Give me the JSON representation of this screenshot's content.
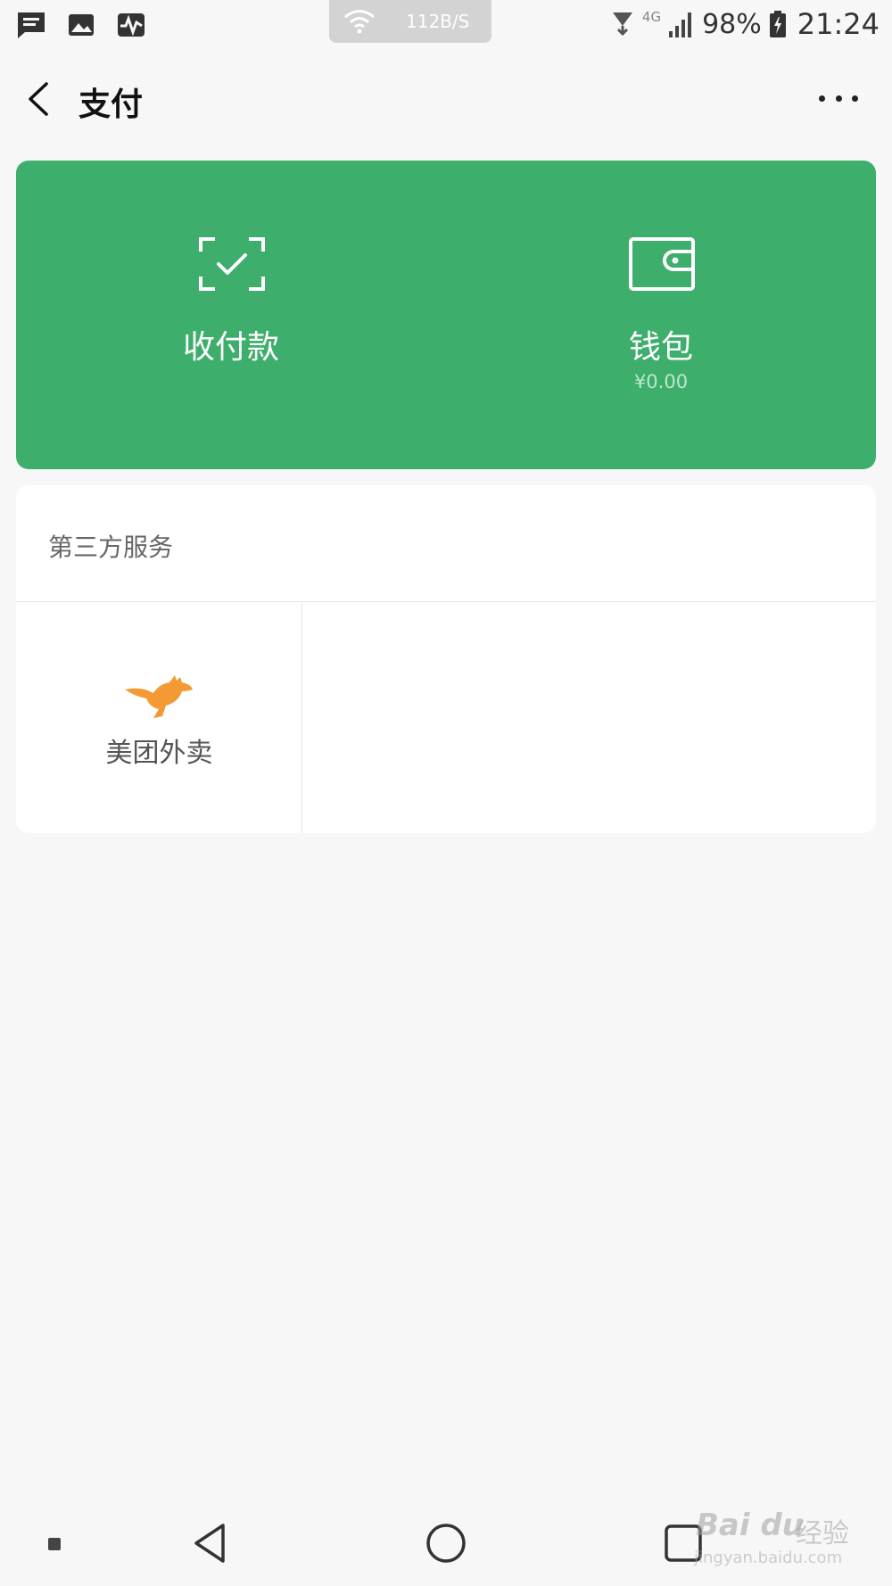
{
  "status_bar": {
    "net_speed": "112B/S",
    "network_type": "4G",
    "battery": "98%",
    "time": "21:24",
    "icons": [
      "message-icon",
      "gallery-icon",
      "activity-icon",
      "wifi-icon",
      "hotspot-icon",
      "signal-icon",
      "battery-icon"
    ]
  },
  "header": {
    "title": "支付",
    "back_icon": "chevron-left-icon",
    "more_icon": "more-dots-icon"
  },
  "pay_card": {
    "background_color": "#3dae6b",
    "items": [
      {
        "label": "收付款",
        "icon": "scan-check-icon"
      },
      {
        "label": "钱包",
        "sub": "¥0.00",
        "icon": "wallet-icon"
      }
    ]
  },
  "third_party": {
    "title": "第三方服务",
    "services": [
      {
        "label": "美团外卖",
        "icon": "kangaroo-icon",
        "color": "#f39a34"
      }
    ]
  },
  "nav_bar": {
    "icons": [
      "menu-square-icon",
      "back-triangle-icon",
      "home-circle-icon",
      "recents-square-icon"
    ]
  },
  "watermark": {
    "brand": "Bai du",
    "cn": "经验",
    "url": "jingyan.baidu.com"
  }
}
